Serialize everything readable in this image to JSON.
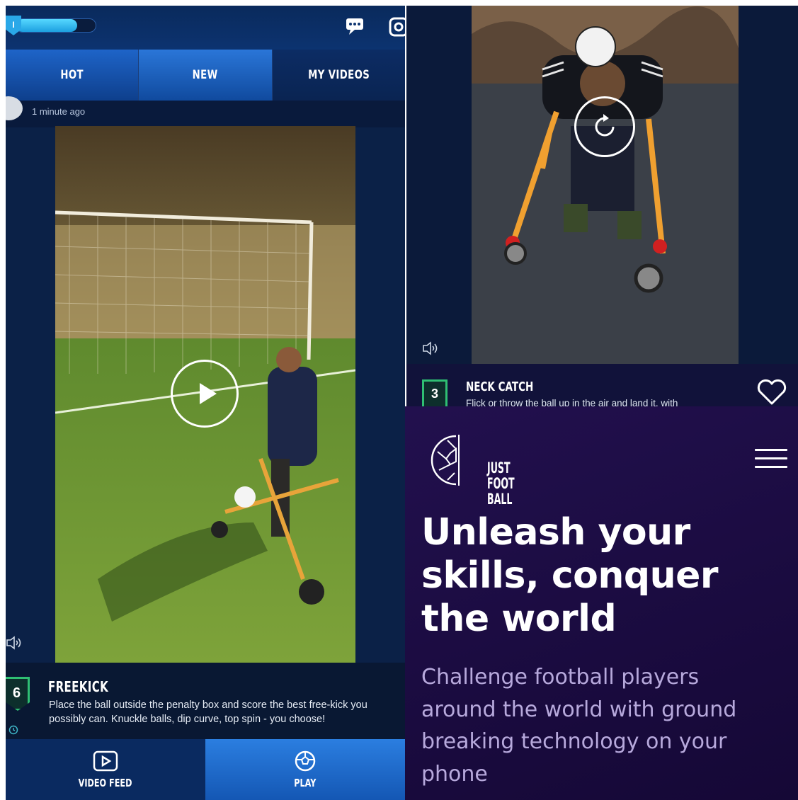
{
  "feed_app": {
    "level": "I",
    "xp_progress": 0.77,
    "tabs": [
      {
        "label": "HOT"
      },
      {
        "label": "NEW"
      },
      {
        "label": "MY VIDEOS"
      }
    ],
    "post_time": "1 minute ago",
    "challenge": {
      "number": "6",
      "title": "FREEKICK",
      "description": "Place the ball outside the penalty box and score the best free-kick you possibly can. Knuckle balls, dip curve, top spin - you choose!"
    },
    "bottom_nav": {
      "video_feed": "VIDEO FEED",
      "play": "PLAY"
    }
  },
  "second_video": {
    "challenge": {
      "number": "3",
      "title": "NECK CATCH",
      "description": "Flick or throw the ball up in the air and land it, with"
    }
  },
  "website": {
    "logo_lines": [
      "JUST",
      "FOOT",
      "BALL"
    ],
    "headline": "Unleash your skills, conquer the world",
    "subtext": "Challenge football players around the world with ground breaking technology on your phone"
  },
  "colors": {
    "primary_blue": "#1e64c8",
    "challenge_green": "#2fbf73",
    "site_purple": "#1a0b3f"
  }
}
